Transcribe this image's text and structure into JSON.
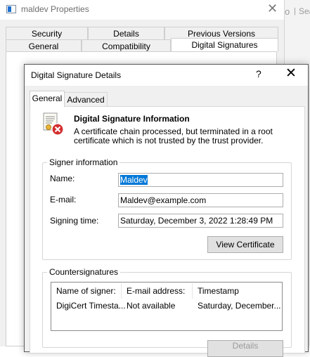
{
  "properties_window": {
    "title": "maldev Properties",
    "tabs_row1": [
      "Security",
      "Details",
      "Previous Versions"
    ],
    "tabs_row2": [
      "General",
      "Compatibility",
      "Digital Signatures"
    ],
    "active_tab": "Digital Signatures"
  },
  "background_window": {
    "text": "Sea",
    "separator": "|",
    "icon": "o"
  },
  "dialog": {
    "title": "Digital Signature Details",
    "help_label": "?",
    "tabs": [
      "General",
      "Advanced"
    ],
    "active_tab": "General",
    "info_title": "Digital Signature Information",
    "info_line1": "A certificate chain processed, but terminated in a root",
    "info_line2": "certificate which is not trusted by the trust provider.",
    "signer": {
      "legend": "Signer information",
      "name_label": "Name:",
      "name_value": "Maldev",
      "email_label": "E-mail:",
      "email_value": "Maldev@example.com",
      "time_label": "Signing time:",
      "time_value": "Saturday, December 3, 2022 1:28:49 PM",
      "view_button": "View Certificate"
    },
    "countersignatures": {
      "legend": "Countersignatures",
      "columns": [
        "Name of signer:",
        "E-mail address:",
        "Timestamp"
      ],
      "rows": [
        [
          "DigiCert Timesta...",
          "Not available",
          "Saturday, December..."
        ]
      ],
      "details_button": "Details"
    }
  },
  "colors": {
    "selection": "#0078d7",
    "error_badge": "#d32f2f",
    "window_bg": "#f0f0f0"
  },
  "icons": [
    "app-icon",
    "close-icon",
    "help-icon",
    "certificate-error-icon"
  ]
}
